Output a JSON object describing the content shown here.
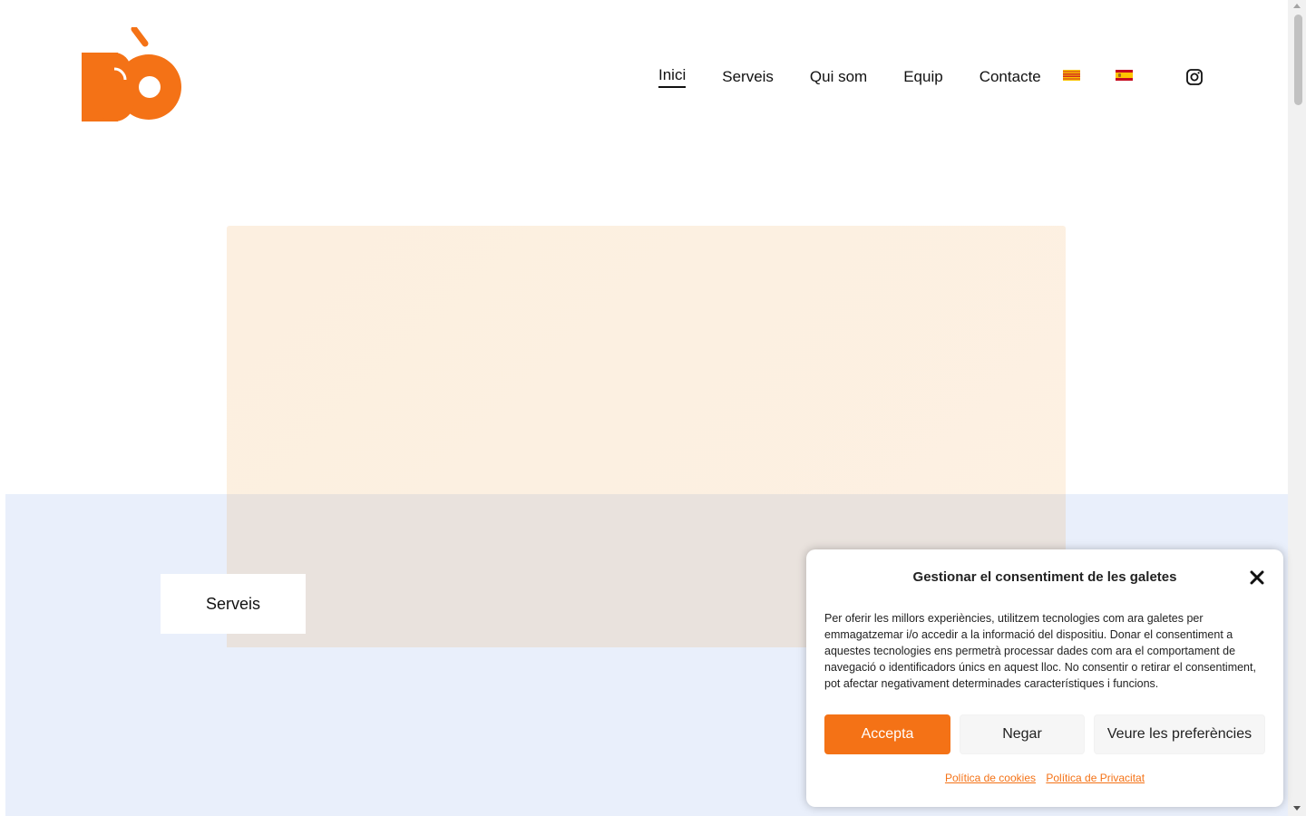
{
  "brand": {
    "accent": "#f47216"
  },
  "nav": {
    "items": [
      {
        "label": "Inici",
        "active": true
      },
      {
        "label": "Serveis"
      },
      {
        "label": "Qui som"
      },
      {
        "label": "Equip"
      },
      {
        "label": "Contacte"
      }
    ],
    "languages": [
      "catalan-flag-icon",
      "spanish-flag-icon"
    ],
    "social_icon": "instagram-icon"
  },
  "hero": {
    "button_label": "Serveis"
  },
  "cookie_banner": {
    "title": "Gestionar el consentiment de les galetes",
    "text": "Per oferir les millors experiències, utilitzem tecnologies com ara galetes per emmagatzemar i/o accedir a la informació del dispositiu. Donar el consentiment a aquestes tecnologies ens permetrà processar dades com ara el comportament de navegació o identificadors únics en aquest lloc. No consentir o retirar el consentiment, pot afectar negativament determinades característiques i funcions.",
    "accept_label": "Accepta",
    "deny_label": "Negar",
    "preferences_label": "Veure les preferències",
    "cookie_policy_link": "Política de cookies",
    "privacy_policy_link": "Política de Privacitat"
  }
}
